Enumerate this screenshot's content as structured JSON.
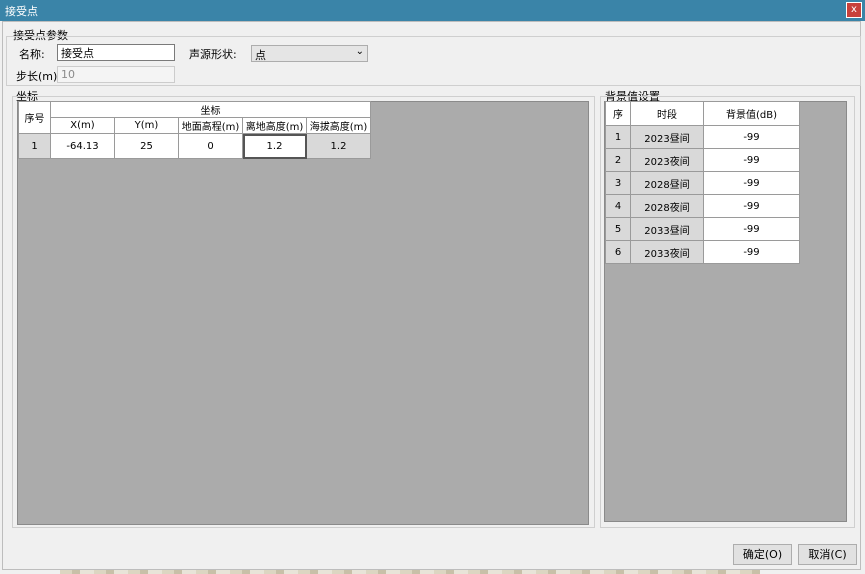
{
  "window": {
    "title": "接受点",
    "close_label": "x"
  },
  "params": {
    "group_title": "接受点参数",
    "name_label": "名称:",
    "name_value": "接受点",
    "shape_label": "声源形状:",
    "shape_value": "点",
    "step_label": "步长(m):",
    "step_value": "10"
  },
  "coords": {
    "group_title": "坐标",
    "header_index": "序号",
    "header_group": "坐标",
    "columns": [
      "X(m)",
      "Y(m)",
      "地面高程(m)",
      "离地高度(m)",
      "海拔高度(m)"
    ],
    "rows": [
      {
        "index": "1",
        "x": "-64.13",
        "y": "25",
        "ground": "0",
        "height": "1.2",
        "altitude": "1.2"
      }
    ]
  },
  "background": {
    "group_title": "背景值设置",
    "columns": [
      "序",
      "时段",
      "背景值(dB)"
    ],
    "rows": [
      {
        "index": "1",
        "period": "2023昼间",
        "value": "-99"
      },
      {
        "index": "2",
        "period": "2023夜间",
        "value": "-99"
      },
      {
        "index": "3",
        "period": "2028昼间",
        "value": "-99"
      },
      {
        "index": "4",
        "period": "2028夜间",
        "value": "-99"
      },
      {
        "index": "5",
        "period": "2033昼间",
        "value": "-99"
      },
      {
        "index": "6",
        "period": "2033夜间",
        "value": "-99"
      }
    ]
  },
  "buttons": {
    "ok": "确定(O)",
    "cancel": "取消(C)"
  },
  "icons": {
    "combo_arrow": "chevron-down-icon"
  },
  "colors": {
    "titlebar": "#3a84a8",
    "close": "#c8413b",
    "grid_bg": "#ababab",
    "readonly_cell": "#d9d9d9"
  }
}
